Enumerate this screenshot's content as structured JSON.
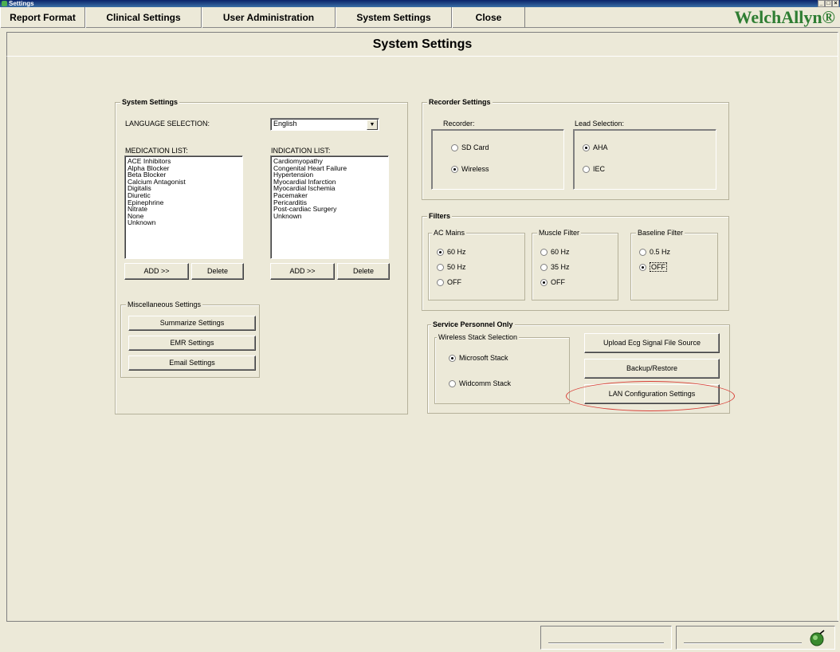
{
  "window": {
    "title": "Settings"
  },
  "nav": {
    "tabs": [
      {
        "label": "Report Format"
      },
      {
        "label": "Clinical Settings"
      },
      {
        "label": "User Administration"
      },
      {
        "label": "System Settings"
      },
      {
        "label": "Close"
      }
    ],
    "brand": "WelchAllyn®"
  },
  "page": {
    "title": "System Settings"
  },
  "system_settings": {
    "title": "System Settings",
    "language_label": "LANGUAGE SELECTION:",
    "language_value": "English",
    "medication_label": "MEDICATION LIST:",
    "medication_items": [
      "ACE Inhibitors",
      "Alpha Blocker",
      "Beta Blocker",
      "Calcium Antagonist",
      "Digitalis",
      "Diuretic",
      "Epinephrine",
      "Nitrate",
      "None",
      "Unknown"
    ],
    "indication_label": "INDICATION LIST:",
    "indication_items": [
      "Cardiomyopathy",
      "Congenital Heart Failure",
      "Hypertension",
      "Myocardial Infarction",
      "Myocardial Ischemia",
      "Pacemaker",
      "Pericarditis",
      "Post-cardiac Surgery",
      "Unknown"
    ],
    "add_label": "ADD >>",
    "delete_label": "Delete",
    "misc": {
      "title": "Miscellaneous Settings",
      "summarize": "Summarize Settings",
      "emr": "EMR Settings",
      "email": "Email Settings"
    }
  },
  "recorder_settings": {
    "title": "Recorder Settings",
    "recorder_label": "Recorder:",
    "sd_card": "SD Card",
    "wireless": "Wireless",
    "lead_label": "Lead Selection:",
    "aha": "AHA",
    "iec": "IEC"
  },
  "filters": {
    "title": "Filters",
    "ac_mains": "AC Mains",
    "ac_60": "60 Hz",
    "ac_50": "50 Hz",
    "ac_off": "OFF",
    "muscle": "Muscle Filter",
    "m_60": "60 Hz",
    "m_35": "35 Hz",
    "m_off": "OFF",
    "baseline": "Baseline Filter",
    "b_05": "0.5 Hz",
    "b_off": "OFF"
  },
  "service": {
    "title": "Service Personnel Only",
    "stack_label": "Wireless Stack Selection",
    "microsoft": "Microsoft Stack",
    "widcomm": "Widcomm Stack",
    "upload": "Upload Ecg Signal File Source",
    "backup": "Backup/Restore",
    "lan": "LAN Configuration Settings"
  },
  "colors": {
    "annotation_ring": "#d9423a",
    "brand": "#2e7d32"
  }
}
